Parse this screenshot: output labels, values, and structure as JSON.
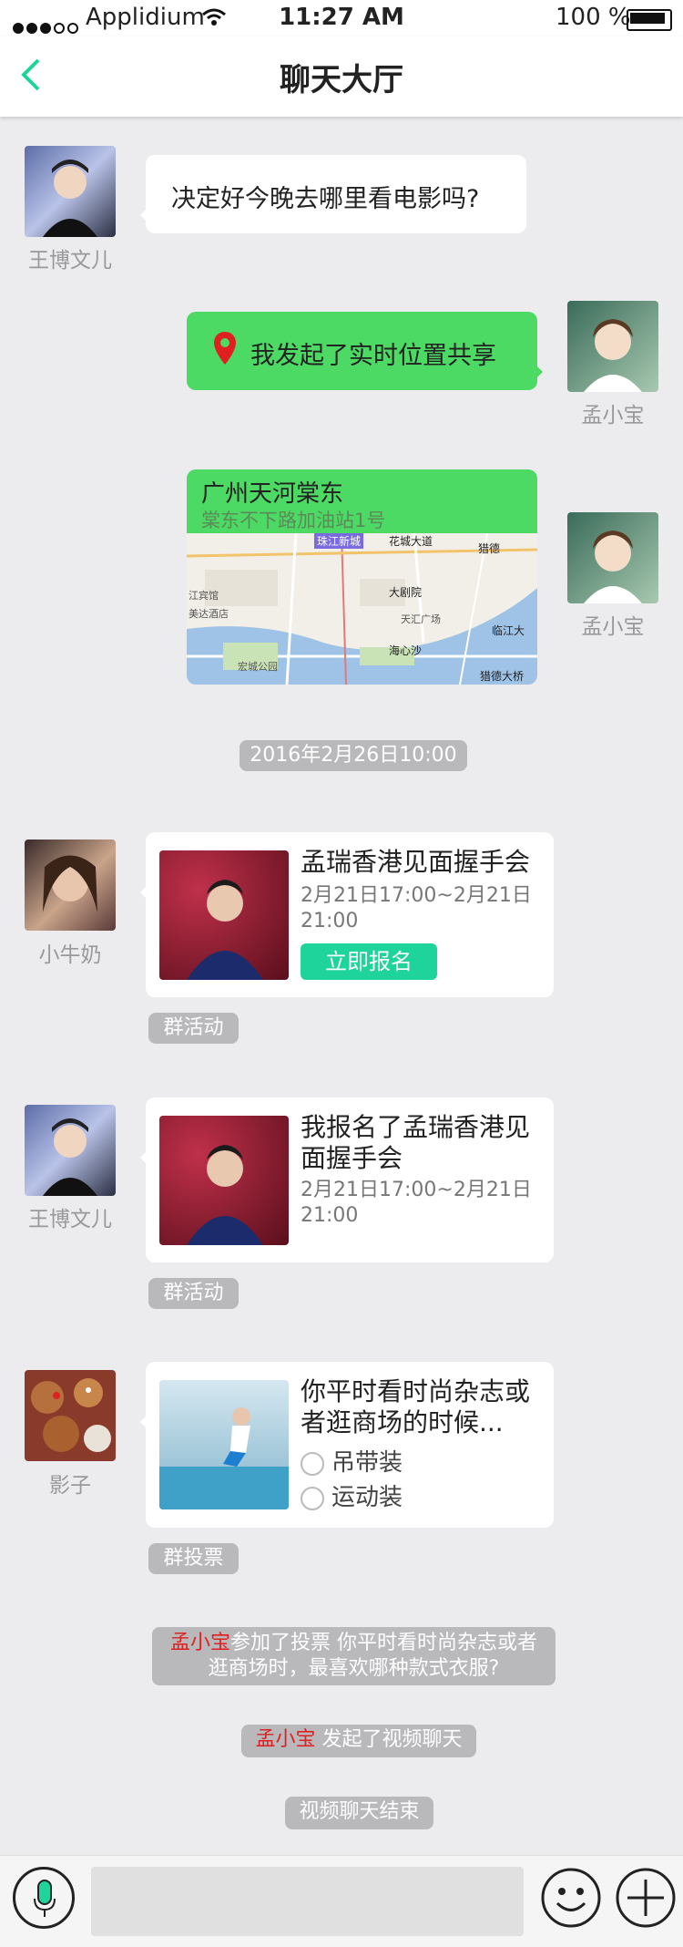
{
  "status_bar": {
    "carrier": "Applidium",
    "time": "11:27 AM",
    "battery": "100 %"
  },
  "nav": {
    "title": "聊天大厅"
  },
  "messages": [
    {
      "name": "王博文儿",
      "text": "决定好今晚去哪里看电影吗?"
    },
    {
      "name": "孟小宝",
      "text": "我发起了实时位置共享"
    },
    {
      "name": "孟小宝",
      "location_title": "广州天河棠东",
      "location_sub": "棠东不下路加油站1号",
      "map_labels": [
        "珠江新城",
        "花城大道",
        "猎德",
        "大剧院",
        "天汇广场",
        "临江大",
        "海心沙",
        "猎德大桥",
        "江宾馆",
        "美达酒店",
        "宏城公园"
      ]
    }
  ],
  "timestamp": "2016年2月26日10:00",
  "event1": {
    "name": "小牛奶",
    "title": "孟瑞香港见面握手会",
    "time": "2月21日17:00~2月21日21:00",
    "button": "立即报名",
    "tag": "群活动"
  },
  "event2": {
    "name": "王博文儿",
    "title": "我报名了孟瑞香港见面握手会",
    "time": "2月21日17:00~2月21日21:00",
    "tag": "群活动"
  },
  "vote": {
    "name": "影子",
    "title": "你平时看时尚杂志或者逛商场的时候...",
    "option1": "吊带装",
    "option2": "运动装",
    "tag": "群投票"
  },
  "notices": [
    {
      "user": "孟小宝",
      "text": "参加了投票 你平时看时尚杂志或者逛商场时，最喜欢哪种款式衣服?"
    },
    {
      "user": "孟小宝",
      "text": " 发起了视频聊天"
    },
    {
      "text": "视频聊天结束"
    }
  ],
  "colors": {
    "green": "#4cd964",
    "accent": "#1fd49b",
    "red": "#e02020"
  }
}
